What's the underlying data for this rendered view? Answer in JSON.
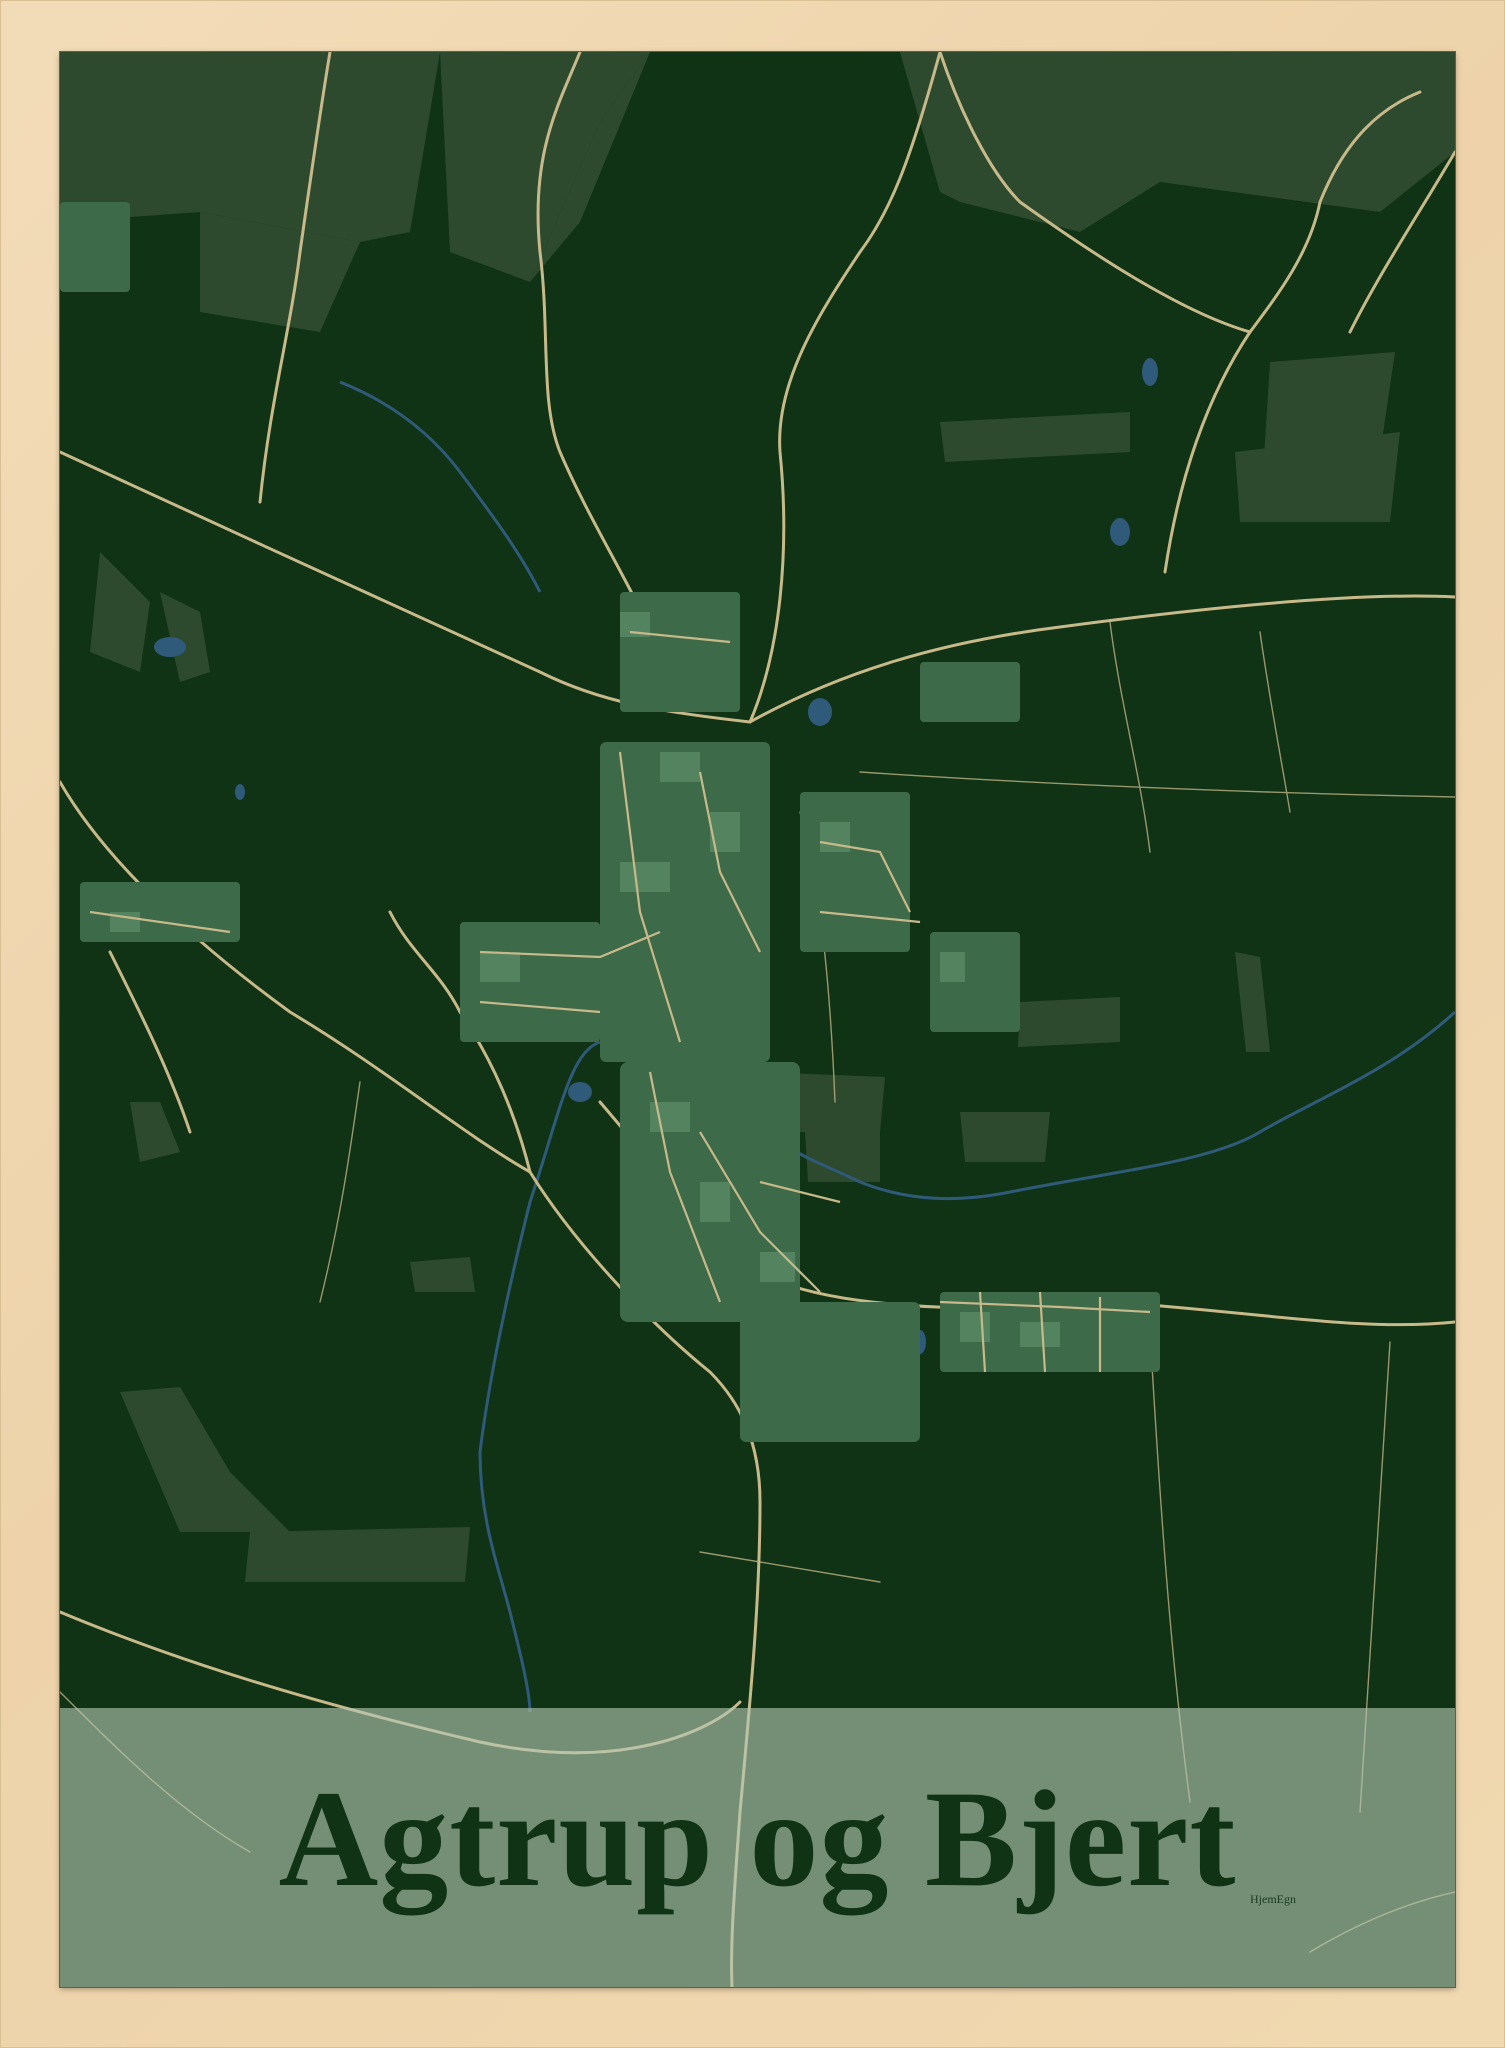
{
  "poster": {
    "title": "Agtrup og Bjert",
    "brand": "HjemEgn"
  },
  "colors": {
    "frame": "#f0d8b0",
    "background": "#0f3314",
    "fields": "#2d4a2f",
    "roads": "#c8b98a",
    "water": "#2f5a7a",
    "buildings": "#4f7a5a",
    "band": "#b4c8b4",
    "title": "#0f3314"
  }
}
